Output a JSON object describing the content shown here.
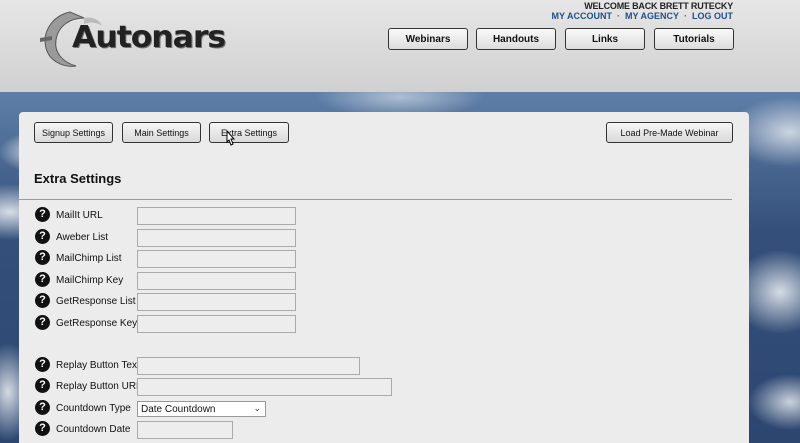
{
  "header": {
    "logo_text": "Autonars",
    "welcome": "WELCOME BACK BRETT RUTECKY",
    "account_links": [
      "MY ACCOUNT",
      "MY AGENCY",
      "LOG OUT"
    ],
    "nav": [
      "Webinars",
      "Handouts",
      "Links",
      "Tutorials"
    ]
  },
  "tabs": {
    "signup": "Signup Settings",
    "main": "Main Settings",
    "extra": "Extra Settings",
    "premade": "Load Pre-Made Webinar"
  },
  "section_title": "Extra Settings",
  "fields": [
    {
      "label": "MailIt URL",
      "value": ""
    },
    {
      "label": "Aweber List",
      "value": ""
    },
    {
      "label": "MailChimp List",
      "value": ""
    },
    {
      "label": "MailChimp Key",
      "value": ""
    },
    {
      "label": "GetResponse List",
      "value": ""
    },
    {
      "label": "GetResponse Key",
      "value": ""
    },
    {
      "label": "Replay Button Text",
      "value": ""
    },
    {
      "label": "Replay Button URL",
      "value": ""
    },
    {
      "label": "Countdown Type",
      "value": "Date Countdown"
    },
    {
      "label": "Countdown Date",
      "value": ""
    }
  ],
  "help_icon_glyph": "?",
  "colors": {
    "link": "#22508a",
    "sky": "#34507a",
    "panel": "#ececec"
  }
}
